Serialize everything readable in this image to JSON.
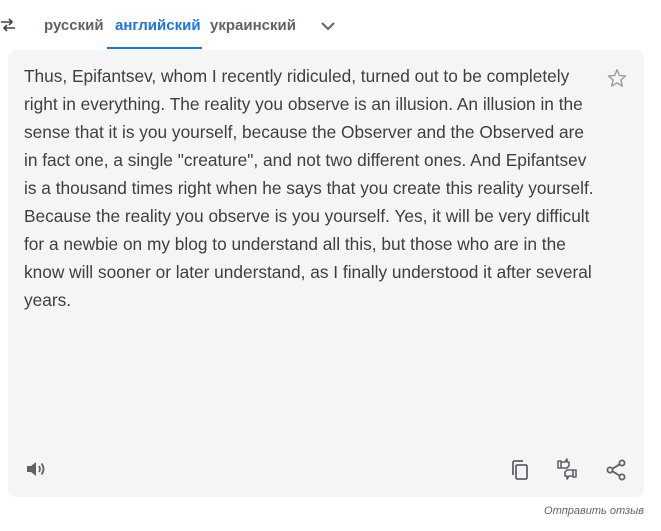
{
  "tabs": {
    "russian": "русский",
    "english": "английский",
    "ukrainian": "украинский"
  },
  "translation": {
    "text": "Thus, Epifantsev, whom I recently ridiculed, turned out to be completely right in everything. The reality you observe is an illusion. An illusion in the sense that it is you yourself, because the Observer and the Observed are in fact one, a single \"creature\", and not two different ones. And Epifantsev is a thousand times right when he says that you create this reality yourself. Because the reality you observe is you yourself. Yes, it will be very difficult for a newbie on my blog to understand all this, but those who are in the know will sooner or later understand, as I finally understood it after several years."
  },
  "feedback_label": "Отправить отзыв",
  "colors": {
    "accent": "#1a73e8",
    "panel_bg": "#f5f5f5",
    "text": "#3c4043",
    "icon": "#5f6368"
  },
  "icons": [
    "swap-languages-icon",
    "chevron-down-icon",
    "star-icon",
    "speaker-icon",
    "copy-icon",
    "rate-translation-icon",
    "share-icon"
  ]
}
